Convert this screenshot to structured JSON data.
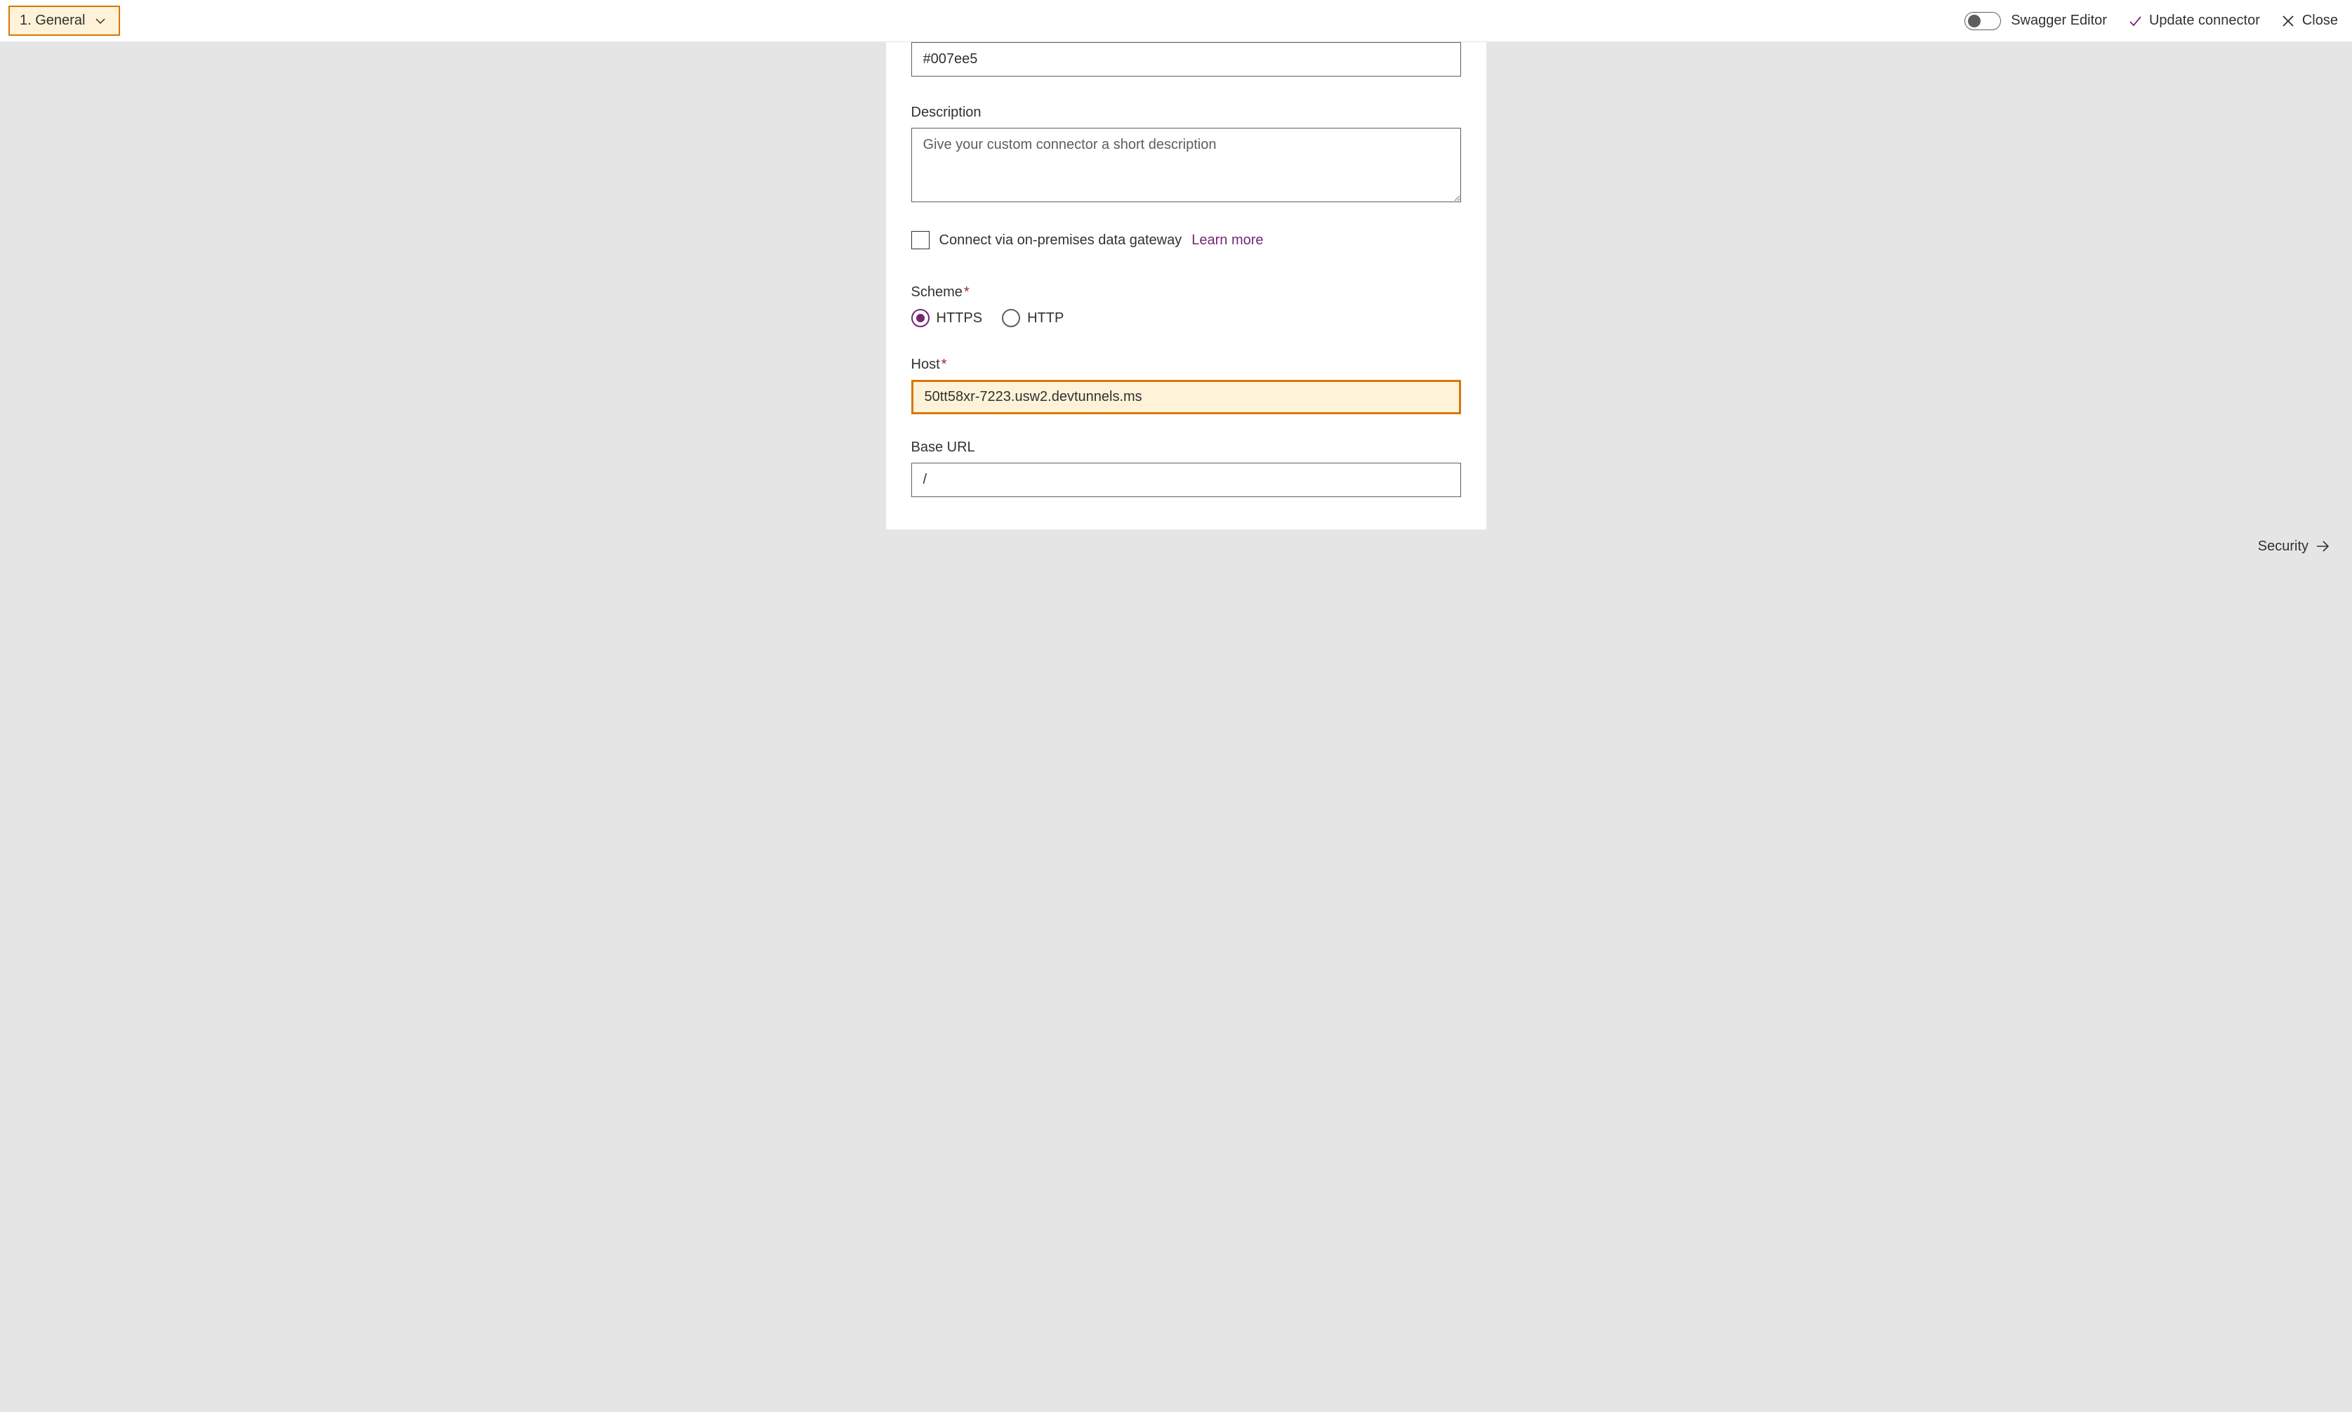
{
  "header": {
    "breadcrumb_label": "1. General",
    "swagger_label": "Swagger Editor",
    "update_label": "Update connector",
    "close_label": "Close"
  },
  "form": {
    "color_value": "#007ee5",
    "description_label": "Description",
    "description_placeholder": "Give your custom connector a short description",
    "description_value": "",
    "gateway_label": "Connect via on-premises data gateway",
    "learn_more": "Learn more",
    "scheme_label": "Scheme",
    "scheme_options": {
      "https": "HTTPS",
      "http": "HTTP"
    },
    "scheme_selected": "HTTPS",
    "host_label": "Host",
    "host_value": "50tt58xr-7223.usw2.devtunnels.ms",
    "baseurl_label": "Base URL",
    "baseurl_value": "/"
  },
  "footer": {
    "next_label": "Security"
  }
}
